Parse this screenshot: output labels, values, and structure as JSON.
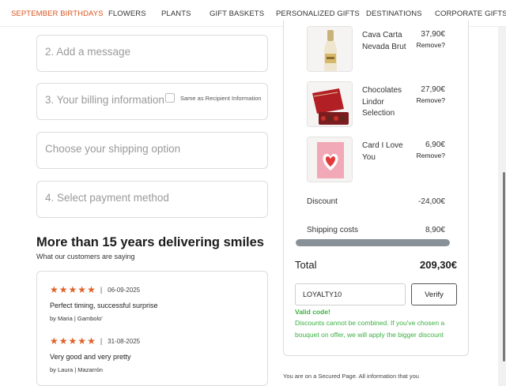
{
  "nav": {
    "items": [
      {
        "label": "SEPTEMBER BIRTHDAYS",
        "active": true
      },
      {
        "label": "FLOWERS"
      },
      {
        "label": "PLANTS"
      },
      {
        "label": "GIFT BASKETS"
      },
      {
        "label": "PERSONALIZED GIFTS"
      },
      {
        "label": "DESTINATIONS"
      },
      {
        "label": "CORPORATE GIFTS"
      }
    ],
    "active_color": "#d9541e"
  },
  "checkout": {
    "message_step": "2. Add a message",
    "billing_step": "3. Your billing information",
    "same_as_recipient_label": "Same as Recipient Information",
    "same_as_recipient_checked": false,
    "shipping_step": "Choose your shipping option",
    "payment_step": "4. Select payment method"
  },
  "reviews": {
    "title": "More than 15 years delivering smiles",
    "subtitle": "What our customers are saying",
    "star_color": "#e0622a",
    "items": [
      {
        "rating": 5,
        "separator": "|",
        "date": "06-09-2025",
        "text": "Perfect timing, successful surprise",
        "author": "by Maria | Gambolo'"
      },
      {
        "rating": 5,
        "separator": "|",
        "date": "31-08-2025",
        "text": "Very good and very pretty",
        "author": "by Laura | Mazarrón"
      }
    ]
  },
  "cart": {
    "items": [
      {
        "name": "Cava Carta Nevada Brut",
        "price": "37,90€",
        "remove_label": "Remove?",
        "icon": "sparkling-wine-bottle-icon"
      },
      {
        "name": "Chocolates Lindor Selection",
        "price": "27,90€",
        "remove_label": "Remove?",
        "icon": "chocolate-box-icon"
      },
      {
        "name": "Card I Love You",
        "price": "6,90€",
        "remove_label": "Remove?",
        "icon": "heart-card-icon"
      }
    ],
    "discount_label": "Discount",
    "discount_value": "-24,00€",
    "shipping_label": "Shipping costs",
    "shipping_value": "8,90€",
    "progress_fraction": 1.0,
    "total_label": "Total",
    "total_value": "209,30€",
    "coupon_value": "LOYALTY10",
    "verify_label": "Verify",
    "valid_label": "Valid code!",
    "valid_color": "#3cb043",
    "discount_note": "Discounts cannot be combined. If you've chosen a bouquet on offer, we will apply the bigger discount"
  },
  "secure_note": "You are on a Secured Page. All information that you"
}
